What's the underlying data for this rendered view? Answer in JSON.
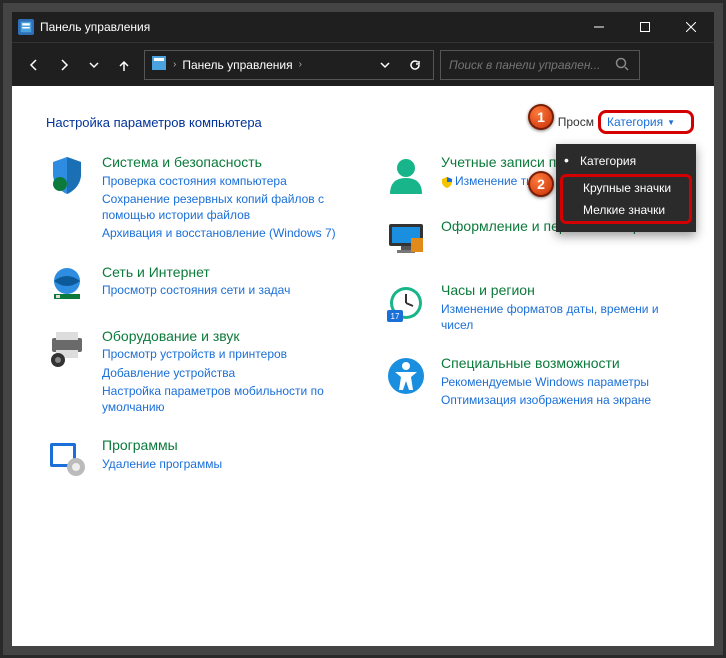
{
  "titlebar": {
    "title": "Панель управления"
  },
  "navbar": {
    "crumb": "Панель управления",
    "search_placeholder": "Поиск в панели управлен..."
  },
  "header": {
    "page_title": "Настройка параметров компьютера",
    "view_label": "Просм",
    "view_value": "Категория"
  },
  "dropdown": {
    "item_category": "Категория",
    "item_large": "Крупные значки",
    "item_small": "Мелкие значки"
  },
  "badges": {
    "one": "1",
    "two": "2"
  },
  "left": {
    "security": {
      "title": "Система и безопасность",
      "l1": "Проверка состояния компьютера",
      "l2": "Сохранение резервных копий файлов с помощью истории файлов",
      "l3": "Архивация и восстановление (Windows 7)"
    },
    "network": {
      "title": "Сеть и Интернет",
      "l1": "Просмотр состояния сети и задач"
    },
    "hardware": {
      "title": "Оборудование и звук",
      "l1": "Просмотр устройств и принтеров",
      "l2": "Добавление устройства",
      "l3": "Настройка параметров мобильности по умолчанию"
    },
    "programs": {
      "title": "Программы",
      "l1": "Удаление программы"
    }
  },
  "right": {
    "users": {
      "title": "Учетные записи пользователей",
      "l1": "Изменение типа"
    },
    "appearance": {
      "title": "Оформление и персонализация"
    },
    "clock": {
      "title": "Часы и регион",
      "l1": "Изменение форматов даты, времени и чисел"
    },
    "ease": {
      "title": "Специальные возможности",
      "l1": "Рекомендуемые Windows параметры",
      "l2": "Оптимизация изображения на экране"
    }
  }
}
